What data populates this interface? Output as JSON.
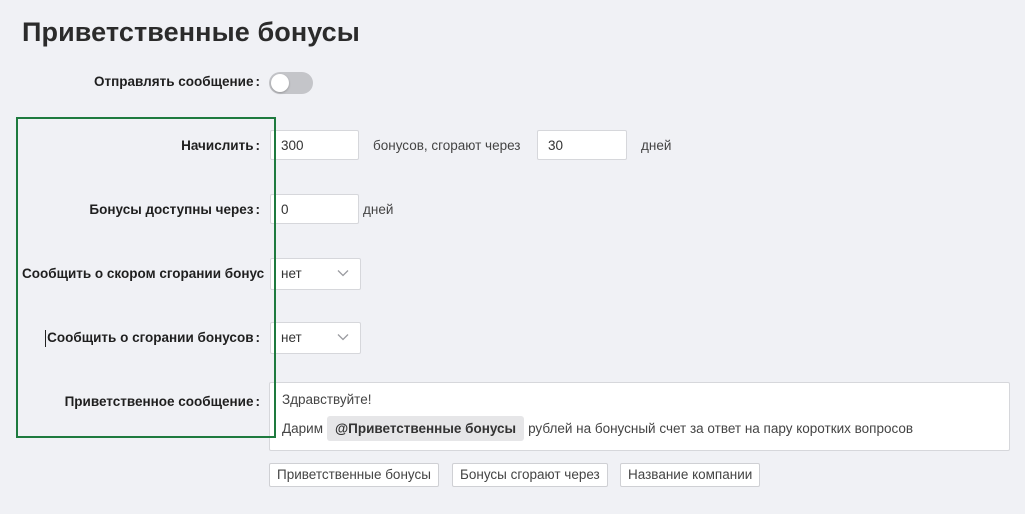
{
  "page": {
    "title": "Приветственные бонусы"
  },
  "send_message": {
    "label": "Отправлять сообщение",
    "colon": ":",
    "enabled": false
  },
  "accrue": {
    "label": "Начислить",
    "colon": ":",
    "amount": "300",
    "middle_text": "бонусов, сгорают через",
    "days_value": "30",
    "days_unit": "дней"
  },
  "available_after": {
    "label": "Бонусы доступны через",
    "colon": ":",
    "value": "0",
    "unit": "дней"
  },
  "notify_soon_expire": {
    "label": "Сообщить о скором сгорании бонус",
    "selected": "нет"
  },
  "notify_expired": {
    "label": "Сообщить о сгорании бонусов",
    "colon": ":",
    "selected": "нет"
  },
  "welcome_message": {
    "label": "Приветственное сообщение",
    "colon": ":",
    "line1": "Здравствуйте!",
    "line2_prefix": "Дарим",
    "tag": "@Приветственные бонусы",
    "line2_suffix": "рублей на бонусный счет за ответ на пару коротких вопросов"
  },
  "variables": [
    {
      "label": "Приветственные бонусы"
    },
    {
      "label": "Бонусы сгорают через"
    },
    {
      "label": "Название компании"
    }
  ],
  "colors": {
    "background": "#f0f1f5",
    "highlight_border": "#1e7a3e",
    "toggle_off": "#c4c5c9"
  }
}
